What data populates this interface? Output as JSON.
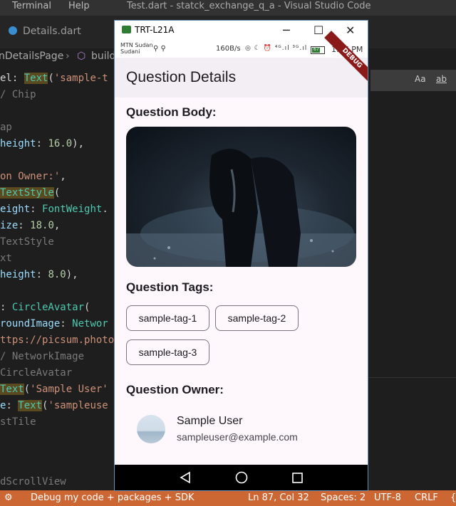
{
  "vscode": {
    "menu": {
      "terminal": "Terminal",
      "help": "Help"
    },
    "window_title": "Test.dart - statck_exchange_q_a - Visual Studio Code",
    "tab_label": "Details.dart",
    "breadcrumb": {
      "page": "nDetailsPage",
      "method": "build"
    },
    "find": {
      "case": "Aa",
      "word": "ab"
    },
    "code_lines": [
      {
        "parts": [
          [
            "",
            "el: "
          ],
          [
            "cls-hl",
            "Text"
          ],
          [
            "",
            "("
          ],
          [
            "str",
            "'sample-t"
          ]
        ]
      },
      {
        "parts": [
          [
            "com",
            "/ Chip"
          ]
        ]
      },
      {
        "parts": []
      },
      {
        "parts": [
          [
            "com",
            "ap"
          ]
        ]
      },
      {
        "parts": [
          [
            "prop",
            "height"
          ],
          [
            "",
            ": "
          ],
          [
            "num",
            "16.0"
          ],
          [
            "",
            "),"
          ]
        ]
      },
      {
        "parts": []
      },
      {
        "parts": [
          [
            "str",
            "on Owner:'"
          ],
          [
            "",
            ","
          ]
        ]
      },
      {
        "parts": [
          [
            "cls-hl",
            "TextStyle"
          ],
          [
            "",
            "("
          ]
        ]
      },
      {
        "parts": [
          [
            "prop",
            "eight"
          ],
          [
            "",
            ": "
          ],
          [
            "cls",
            "FontWeight"
          ],
          [
            "",
            "."
          ]
        ]
      },
      {
        "parts": [
          [
            "prop",
            "ize"
          ],
          [
            "",
            ": "
          ],
          [
            "num",
            "18.0"
          ],
          [
            "",
            ","
          ]
        ]
      },
      {
        "parts": [
          [
            "com",
            "TextStyle"
          ]
        ]
      },
      {
        "parts": [
          [
            "com",
            "xt"
          ]
        ]
      },
      {
        "parts": [
          [
            "prop",
            "height"
          ],
          [
            "",
            ": "
          ],
          [
            "num",
            "8.0"
          ],
          [
            "",
            "),"
          ]
        ]
      },
      {
        "parts": []
      },
      {
        "parts": [
          [
            "",
            ": "
          ],
          [
            "cls",
            "CircleAvatar"
          ],
          [
            "",
            "("
          ]
        ]
      },
      {
        "parts": [
          [
            "prop",
            "roundImage"
          ],
          [
            "",
            ": "
          ],
          [
            "cls",
            "Networ"
          ]
        ]
      },
      {
        "parts": [
          [
            "str",
            "ttps://picsum.photo"
          ]
        ]
      },
      {
        "parts": [
          [
            "com",
            "/ NetworkImage"
          ]
        ]
      },
      {
        "parts": [
          [
            "com",
            "CircleAvatar"
          ]
        ]
      },
      {
        "parts": [
          [
            "cls-hl",
            "Text"
          ],
          [
            "",
            "("
          ],
          [
            "str",
            "'Sample User'"
          ]
        ]
      },
      {
        "parts": [
          [
            "prop",
            "e"
          ],
          [
            "",
            ": "
          ],
          [
            "cls-hl",
            "Text"
          ],
          [
            "",
            "("
          ],
          [
            "str",
            "'sampleuse"
          ]
        ]
      },
      {
        "parts": [
          [
            "com",
            "stTile"
          ]
        ]
      }
    ],
    "code_bottom": "dScrollView",
    "status": {
      "debug": "Debug my code + packages + SDK",
      "position": "Ln 87, Col 32",
      "spaces": "Spaces: 2",
      "encoding": "UTF-8",
      "eol": "CRLF",
      "lang": "{"
    }
  },
  "emulator": {
    "window_title": "TRT-L21A",
    "controls": {
      "minimize": "─",
      "maximize": "☐",
      "close": "✕"
    },
    "status_bar": {
      "carrier_line1": "MTN Sudan",
      "carrier_line2": "Sudani",
      "usb": "⚲ ⚲",
      "net_speed": "160B/s",
      "status_icons": "◎ ☾ ⏰ ⁴ᴳ.ıl ³ᴳ.ıl",
      "battery": "67",
      "battery_level": 0.67,
      "time": "1:16 PM"
    },
    "debug_banner": "DEBUG",
    "app": {
      "title": "Question Details",
      "body_heading": "Question Body:",
      "tags_heading": "Question Tags:",
      "tags": [
        "sample-tag-1",
        "sample-tag-2",
        "sample-tag-3"
      ],
      "owner_heading": "Question Owner:",
      "owner": {
        "name": "Sample User",
        "email": "sampleuser@example.com"
      }
    },
    "nav": {
      "back": "◁",
      "home": "○",
      "recents": "□"
    }
  }
}
